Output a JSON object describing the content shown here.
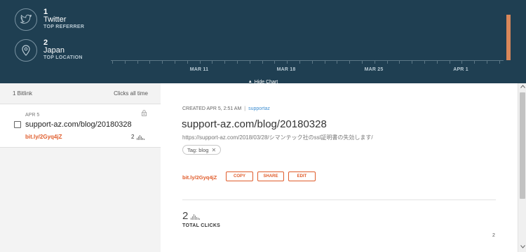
{
  "stats": {
    "referrer": {
      "count": "1",
      "name": "Twitter",
      "label": "TOP REFERRER",
      "icon": "twitter-icon"
    },
    "location": {
      "count": "2",
      "name": "Japan",
      "label": "TOP LOCATION",
      "icon": "location-pin-icon"
    }
  },
  "chart_data": {
    "type": "bar",
    "categories": [
      "MAR 11",
      "MAR 18",
      "MAR 25",
      "APR 1"
    ],
    "bar_color": "#d9875a",
    "series": [
      {
        "values": [
          0,
          0,
          0,
          0
        ]
      }
    ],
    "peak_date_value": 2
  },
  "toggle": {
    "label": "Hide Chart"
  },
  "list": {
    "count_label": "1 Bitlink",
    "sort_label": "Clicks all time",
    "items": [
      {
        "date": "APR 5",
        "title": "support-az.com/blog/20180328",
        "short": "bit.ly/2Gyq4jZ",
        "clicks": "2"
      }
    ]
  },
  "detail": {
    "created": "CREATED APR 5, 2:51 AM",
    "user": "supportaz",
    "title": "support-az.com/blog/20180328",
    "url": "https://support-az.com/2018/03/28/シマンテック社のssl証明書の失効します/",
    "tag": "Tag: blog",
    "short": "bit.ly/2Gyq4jZ",
    "buttons": {
      "copy": "COPY",
      "share": "SHARE",
      "edit": "EDIT"
    },
    "total": "2",
    "total_label": "TOTAL CLICKS",
    "count_right": "2"
  },
  "colors": {
    "header_bg": "#1f3f52",
    "accent": "#e05c2b",
    "link": "#3f8fd2"
  }
}
